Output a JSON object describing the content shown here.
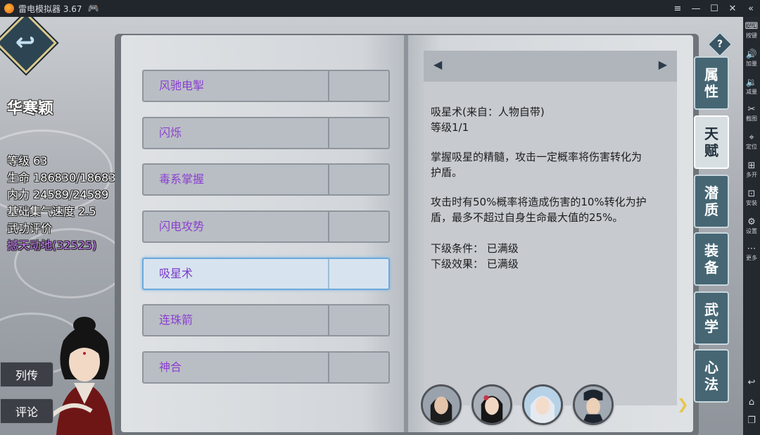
{
  "titlebar": {
    "title": "雷电模拟器 3.67",
    "icons": [
      "app-logo-icon",
      "gamepad-icon",
      "menu-icon",
      "minimize-icon",
      "maximize-icon",
      "close-icon",
      "collapse-icon"
    ]
  },
  "sidetool": {
    "items": [
      {
        "label": "按键",
        "icon": "keyboard-icon"
      },
      {
        "label": "加量",
        "icon": "volume-up-icon"
      },
      {
        "label": "减量",
        "icon": "volume-down-icon"
      },
      {
        "label": "截图",
        "icon": "scissors-icon"
      },
      {
        "label": "定位",
        "icon": "location-icon"
      },
      {
        "label": "多开",
        "icon": "multi-instance-icon"
      },
      {
        "label": "安装",
        "icon": "apk-install-icon"
      },
      {
        "label": "设置",
        "icon": "gear-icon"
      },
      {
        "label": "更多",
        "icon": "more-icon"
      }
    ],
    "nav_icons": [
      "back-icon",
      "home-icon",
      "recent-apps-icon"
    ]
  },
  "character": {
    "name": "华寒颖",
    "level": "等级 63",
    "hp": "生命 186830/186830",
    "mp": "内力 24589/24589",
    "qi_speed": "基础集气速度 2.5",
    "martial_rating_label": "武功评价",
    "martial_rating_value": "撼天动地(32525)"
  },
  "side_buttons": {
    "biography": "列传",
    "comment": "评论"
  },
  "skills": [
    {
      "name": "风驰电掣",
      "selected": false
    },
    {
      "name": "闪烁",
      "selected": false
    },
    {
      "name": "毒系掌握",
      "selected": false
    },
    {
      "name": "闪电攻势",
      "selected": false
    },
    {
      "name": "吸星术",
      "selected": true
    },
    {
      "name": "连珠箭",
      "selected": false
    },
    {
      "name": "神合",
      "selected": false
    }
  ],
  "detail": {
    "title": "吸星术(来自：人物自带)",
    "level": "等级1/1",
    "desc1_line1": "掌握吸星的精髓，攻击一定概率将伤害转化为",
    "desc1_line2": "护盾。",
    "desc2_line1": "攻击时有50%概率将造成伤害的10%转化为护",
    "desc2_line2": "盾，最多不超过自身生命最大值的25%。",
    "next_condition": "下级条件：  已满级",
    "next_effect": "下级效果：  已满级"
  },
  "tabs": [
    {
      "label1": "属",
      "label2": "性",
      "active": false
    },
    {
      "label1": "天",
      "label2": "赋",
      "active": true
    },
    {
      "label1": "潜",
      "label2": "质",
      "active": false
    },
    {
      "label1": "装",
      "label2": "备",
      "active": false
    },
    {
      "label1": "武",
      "label2": "学",
      "active": false
    },
    {
      "label1": "心",
      "label2": "法",
      "active": false
    }
  ],
  "help": "?",
  "arrows": {
    "prev": "◀",
    "next": "▶",
    "page_next": "❯"
  },
  "colors": {
    "skill_name": "#8b3fd0",
    "rating_purple": "#c27cf0",
    "tab_bg": "#466674",
    "tab_active_bg": "#d8dfe3",
    "selected_highlight": "#6da9db"
  }
}
